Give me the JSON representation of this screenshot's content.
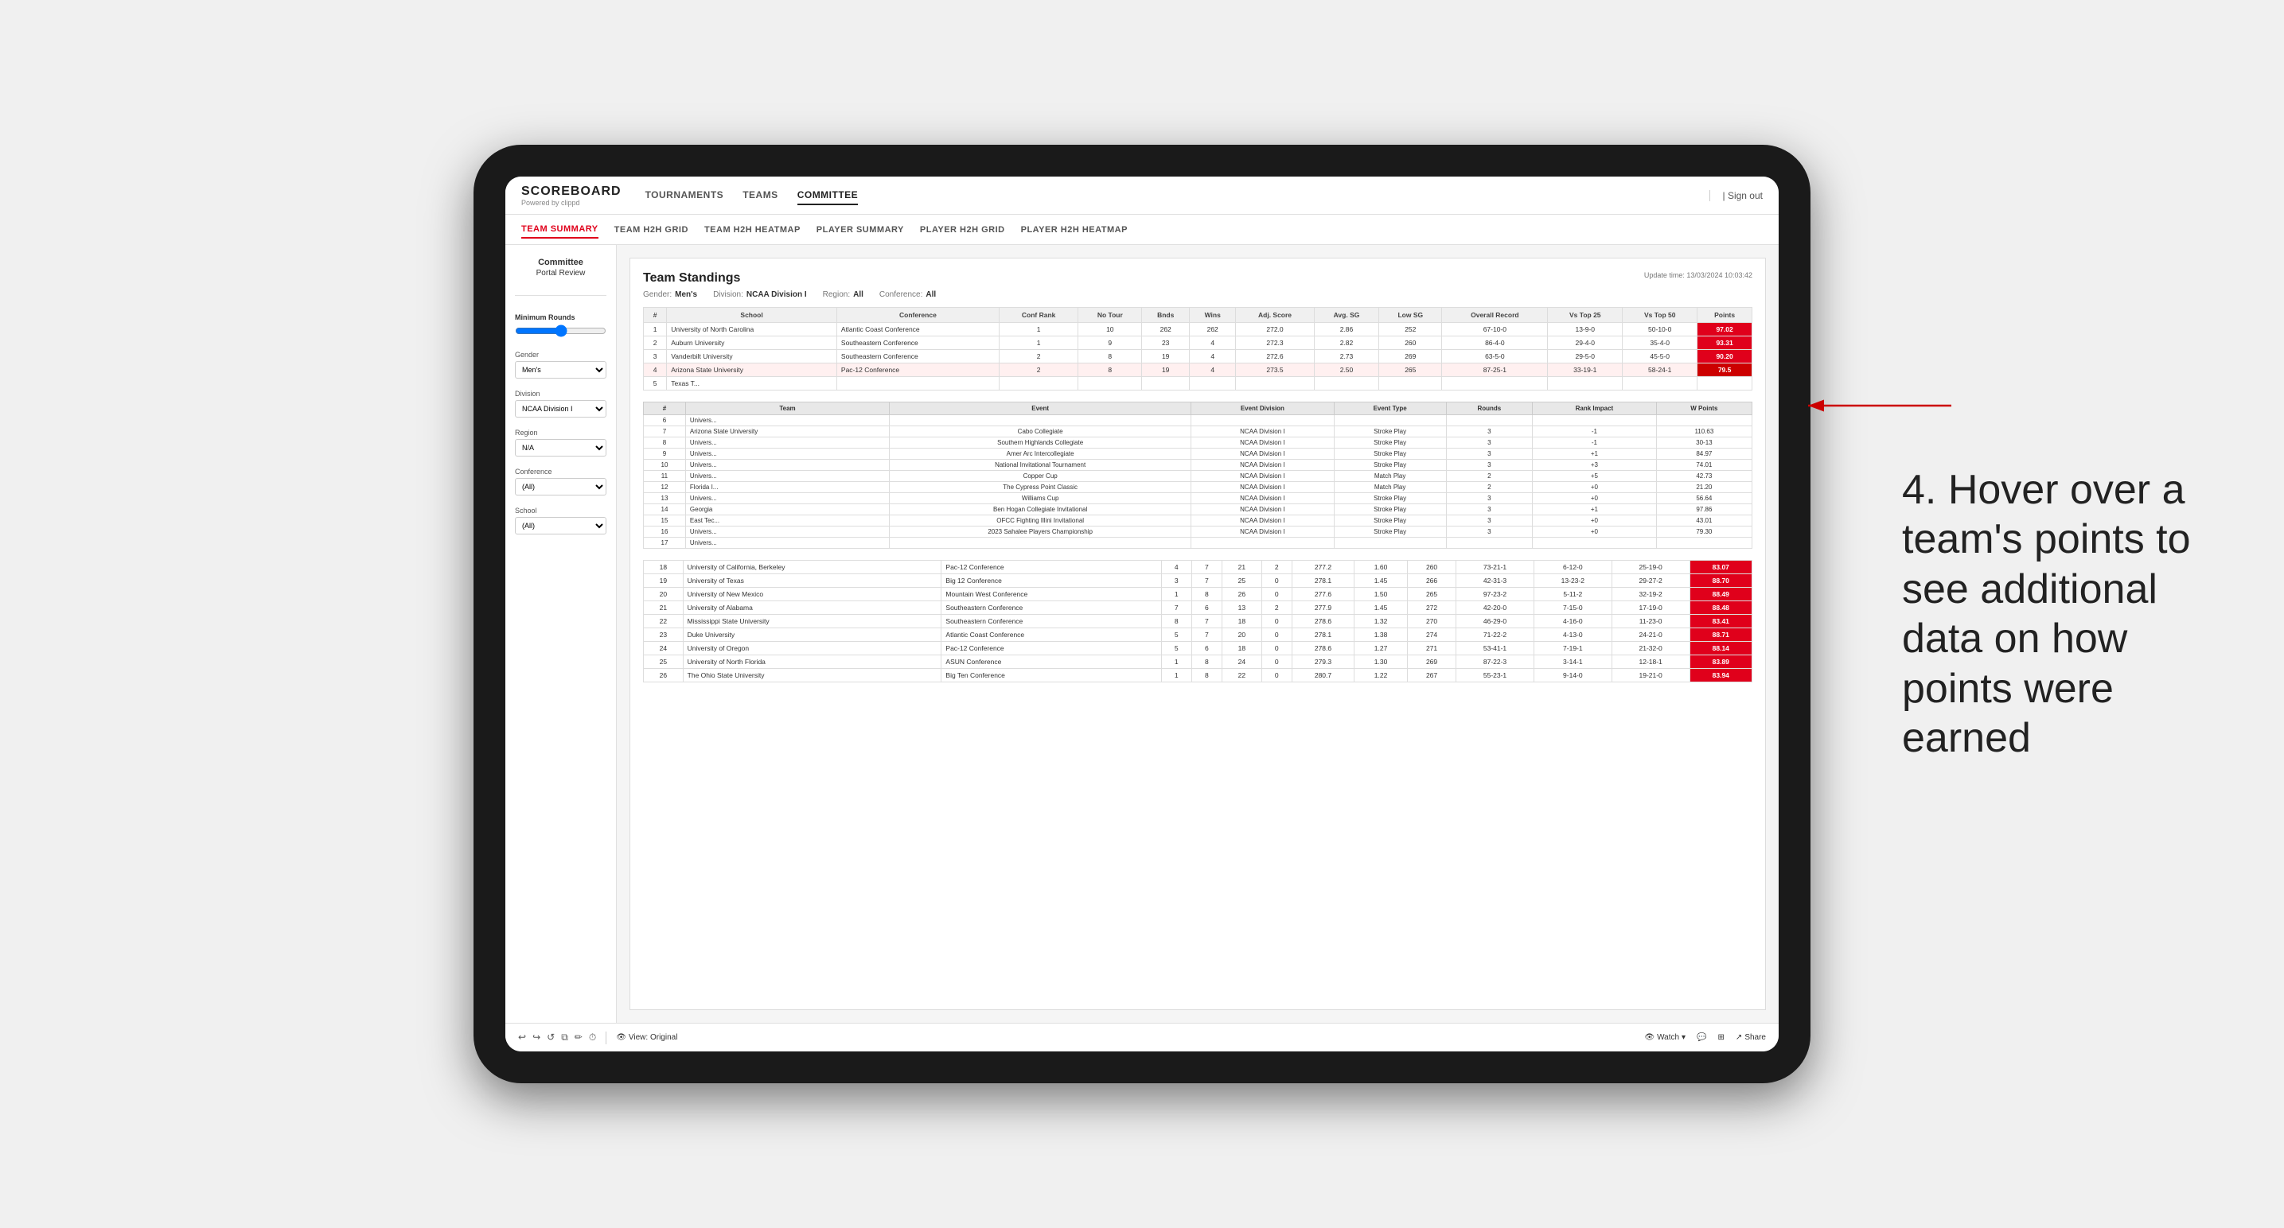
{
  "app": {
    "logo": "SCOREBOARD",
    "logo_sub": "Powered by clippd",
    "sign_out": "Sign out"
  },
  "nav": {
    "items": [
      {
        "label": "TOURNAMENTS",
        "active": false
      },
      {
        "label": "TEAMS",
        "active": false
      },
      {
        "label": "COMMITTEE",
        "active": true
      }
    ]
  },
  "sub_nav": {
    "items": [
      {
        "label": "TEAM SUMMARY",
        "active": true
      },
      {
        "label": "TEAM H2H GRID",
        "active": false
      },
      {
        "label": "TEAM H2H HEATMAP",
        "active": false
      },
      {
        "label": "PLAYER SUMMARY",
        "active": false
      },
      {
        "label": "PLAYER H2H GRID",
        "active": false
      },
      {
        "label": "PLAYER H2H HEATMAP",
        "active": false
      }
    ]
  },
  "sidebar": {
    "committee_title": "Committee",
    "committee_subtitle": "Portal Review",
    "min_rounds_label": "Minimum Rounds",
    "gender_label": "Gender",
    "gender_value": "Men's",
    "division_label": "Division",
    "division_value": "NCAA Division I",
    "region_label": "Region",
    "region_value": "N/A",
    "conference_label": "Conference",
    "conference_value": "(All)",
    "school_label": "School",
    "school_value": "(All)"
  },
  "report": {
    "title": "Team Standings",
    "update_time": "Update time: 13/03/2024 10:03:42",
    "filters": {
      "gender_label": "Gender:",
      "gender_value": "Men's",
      "division_label": "Division:",
      "division_value": "NCAA Division I",
      "region_label": "Region:",
      "region_value": "All",
      "conference_label": "Conference:",
      "conference_value": "All"
    },
    "columns": [
      "#",
      "School",
      "Conference",
      "Conf Rank",
      "No Tour",
      "Bnds",
      "Wins",
      "Adj. Score",
      "Avg. SG",
      "Low SG",
      "Overall Record",
      "Vs Top 25",
      "Vs Top 50",
      "Points"
    ],
    "rows": [
      {
        "rank": 1,
        "school": "University of North Carolina",
        "conference": "Atlantic Coast Conference",
        "conf_rank": 1,
        "tours": 10,
        "bnds": 262,
        "wins": 262,
        "adj_score": 272.0,
        "avg_sg": 2.86,
        "low_sg": 252,
        "overall": "67-10-0",
        "vs25": "13-9-0",
        "vs50": "50-10-0",
        "points": "97.02",
        "highlight": false
      },
      {
        "rank": 2,
        "school": "Auburn University",
        "conference": "Southeastern Conference",
        "conf_rank": 1,
        "tours": 9,
        "bnds": 23,
        "wins": 4,
        "adj_score": 272.3,
        "avg_sg": 2.82,
        "low_sg": 260,
        "overall": "86-4-0",
        "vs25": "29-4-0",
        "vs50": "35-4-0",
        "points": "93.31",
        "highlight": false
      },
      {
        "rank": 3,
        "school": "Vanderbilt University",
        "conference": "Southeastern Conference",
        "conf_rank": 2,
        "tours": 8,
        "bnds": 19,
        "wins": 4,
        "adj_score": 272.6,
        "avg_sg": 2.73,
        "low_sg": 269,
        "overall": "63-5-0",
        "vs25": "29-5-0",
        "vs50": "45-5-0",
        "points": "90.20",
        "highlight": false
      },
      {
        "rank": 4,
        "school": "Arizona State University",
        "conference": "Pac-12 Conference",
        "conf_rank": 2,
        "tours": 8,
        "bnds": 19,
        "wins": 4,
        "adj_score": 273.5,
        "avg_sg": 2.5,
        "low_sg": 265,
        "overall": "87-25-1",
        "vs25": "33-19-1",
        "vs50": "58-24-1",
        "points": "79.5",
        "highlight": true
      },
      {
        "rank": 5,
        "school": "Texas T...",
        "conference": "",
        "conf_rank": "",
        "tours": "",
        "bnds": "",
        "wins": "",
        "adj_score": "",
        "avg_sg": "",
        "low_sg": "",
        "overall": "",
        "vs25": "",
        "vs50": "",
        "points": "",
        "highlight": false
      }
    ],
    "tooltip_columns": [
      "#",
      "Team",
      "Event",
      "Event Division",
      "Event Type",
      "Rounds",
      "Rank Impact",
      "W Points"
    ],
    "tooltip_rows": [
      {
        "rank": 6,
        "team": "Univers...",
        "event": "",
        "division": "",
        "type": "",
        "rounds": "",
        "impact": "",
        "points": ""
      },
      {
        "rank": 7,
        "team": "Arizona State",
        "event": "Cabo Collegiate",
        "division": "NCAA Division I",
        "type": "Stroke Play",
        "rounds": 3,
        "impact": "-1",
        "points": "110.63"
      },
      {
        "rank": 8,
        "team": "Univers...",
        "event": "Southern Highlands Collegiate",
        "division": "NCAA Division I",
        "type": "Stroke Play",
        "rounds": 3,
        "impact": "-1",
        "points": "30-13"
      },
      {
        "rank": 9,
        "team": "Univers...",
        "event": "Amer Arc Intercollegiate",
        "division": "NCAA Division I",
        "type": "Stroke Play",
        "rounds": 3,
        "impact": "+1",
        "points": "84.97"
      },
      {
        "rank": 10,
        "team": "Univers...",
        "event": "National Invitational Tournament",
        "division": "NCAA Division I",
        "type": "Stroke Play",
        "rounds": 3,
        "impact": "+3",
        "points": "74.01"
      },
      {
        "rank": 11,
        "team": "Univers...",
        "event": "Copper Cup",
        "division": "NCAA Division I",
        "type": "Match Play",
        "rounds": 2,
        "impact": "+5",
        "points": "42.73"
      },
      {
        "rank": 12,
        "team": "Florida I...",
        "event": "The Cypress Point Classic",
        "division": "NCAA Division I",
        "type": "Match Play",
        "rounds": 2,
        "impact": "+0",
        "points": "21.20"
      },
      {
        "rank": 13,
        "team": "Univers...",
        "event": "Williams Cup",
        "division": "NCAA Division I",
        "type": "Stroke Play",
        "rounds": 3,
        "impact": "+0",
        "points": "56.64"
      },
      {
        "rank": 14,
        "team": "Georgia",
        "event": "Ben Hogan Collegiate Invitational",
        "division": "NCAA Division I",
        "type": "Stroke Play",
        "rounds": 3,
        "impact": "+1",
        "points": "97.86"
      },
      {
        "rank": 15,
        "team": "East Tec...",
        "event": "OFCC Fighting Illini Invitational",
        "division": "NCAA Division I",
        "type": "Stroke Play",
        "rounds": 3,
        "impact": "+0",
        "points": "43.01"
      },
      {
        "rank": 16,
        "team": "Univers...",
        "event": "2023 Sahalee Players Championship",
        "division": "NCAA Division I",
        "type": "Stroke Play",
        "rounds": 3,
        "impact": "+0",
        "points": "79.30"
      },
      {
        "rank": 17,
        "team": "Univers...",
        "event": "",
        "division": "",
        "type": "",
        "rounds": "",
        "impact": "",
        "points": ""
      }
    ],
    "bottom_rows": [
      {
        "rank": 18,
        "school": "University of California, Berkeley",
        "conference": "Pac-12 Conference",
        "conf_rank": 4,
        "tours": 7,
        "bnds": 21,
        "wins": 2,
        "adj_score": 277.2,
        "avg_sg": 1.6,
        "low_sg": 260,
        "overall": "73-21-1",
        "vs25": "6-12-0",
        "vs50": "25-19-0",
        "points": "83.07"
      },
      {
        "rank": 19,
        "school": "University of Texas",
        "conference": "Big 12 Conference",
        "conf_rank": 3,
        "tours": 7,
        "bnds": 25,
        "wins": 0,
        "adj_score": 278.1,
        "avg_sg": 1.45,
        "low_sg": 266,
        "overall": "42-31-3",
        "vs25": "13-23-2",
        "vs50": "29-27-2",
        "points": "88.70"
      },
      {
        "rank": 20,
        "school": "University of New Mexico",
        "conference": "Mountain West Conference",
        "conf_rank": 1,
        "tours": 8,
        "bnds": 26,
        "wins": 0,
        "adj_score": 277.6,
        "avg_sg": 1.5,
        "low_sg": 265,
        "overall": "97-23-2",
        "vs25": "5-11-2",
        "vs50": "32-19-2",
        "points": "88.49"
      },
      {
        "rank": 21,
        "school": "University of Alabama",
        "conference": "Southeastern Conference",
        "conf_rank": 7,
        "tours": 6,
        "bnds": 13,
        "wins": 2,
        "adj_score": 277.9,
        "avg_sg": 1.45,
        "low_sg": 272,
        "overall": "42-20-0",
        "vs25": "7-15-0",
        "vs50": "17-19-0",
        "points": "88.48"
      },
      {
        "rank": 22,
        "school": "Mississippi State University",
        "conference": "Southeastern Conference",
        "conf_rank": 8,
        "tours": 7,
        "bnds": 18,
        "wins": 0,
        "adj_score": 278.6,
        "avg_sg": 1.32,
        "low_sg": 270,
        "overall": "46-29-0",
        "vs25": "4-16-0",
        "vs50": "11-23-0",
        "points": "83.41"
      },
      {
        "rank": 23,
        "school": "Duke University",
        "conference": "Atlantic Coast Conference",
        "conf_rank": 5,
        "tours": 7,
        "bnds": 20,
        "wins": 0,
        "adj_score": 278.1,
        "avg_sg": 1.38,
        "low_sg": 274,
        "overall": "71-22-2",
        "vs25": "4-13-0",
        "vs50": "24-21-0",
        "points": "88.71"
      },
      {
        "rank": 24,
        "school": "University of Oregon",
        "conference": "Pac-12 Conference",
        "conf_rank": 5,
        "tours": 6,
        "bnds": 18,
        "wins": 0,
        "adj_score": 278.6,
        "avg_sg": 1.27,
        "low_sg": 271,
        "overall": "53-41-1",
        "vs25": "7-19-1",
        "vs50": "21-32-0",
        "points": "88.14"
      },
      {
        "rank": 25,
        "school": "University of North Florida",
        "conference": "ASUN Conference",
        "conf_rank": 1,
        "tours": 8,
        "bnds": 24,
        "wins": 0,
        "adj_score": 279.3,
        "avg_sg": 1.3,
        "low_sg": 269,
        "overall": "87-22-3",
        "vs25": "3-14-1",
        "vs50": "12-18-1",
        "points": "83.89"
      },
      {
        "rank": 26,
        "school": "The Ohio State University",
        "conference": "Big Ten Conference",
        "conf_rank": 1,
        "tours": 8,
        "bnds": 22,
        "wins": 0,
        "adj_score": 280.7,
        "avg_sg": 1.22,
        "low_sg": 267,
        "overall": "55-23-1",
        "vs25": "9-14-0",
        "vs50": "19-21-0",
        "points": "83.94"
      }
    ]
  },
  "toolbar": {
    "undo": "↩",
    "redo": "↪",
    "reset": "↺",
    "copy": "⧉",
    "edit": "✏",
    "clock": "⏱",
    "view_label": "View: Original",
    "watch_label": "Watch",
    "share_label": "Share"
  },
  "annotation": {
    "text": "4. Hover over a team's points to see additional data on how points were earned"
  }
}
